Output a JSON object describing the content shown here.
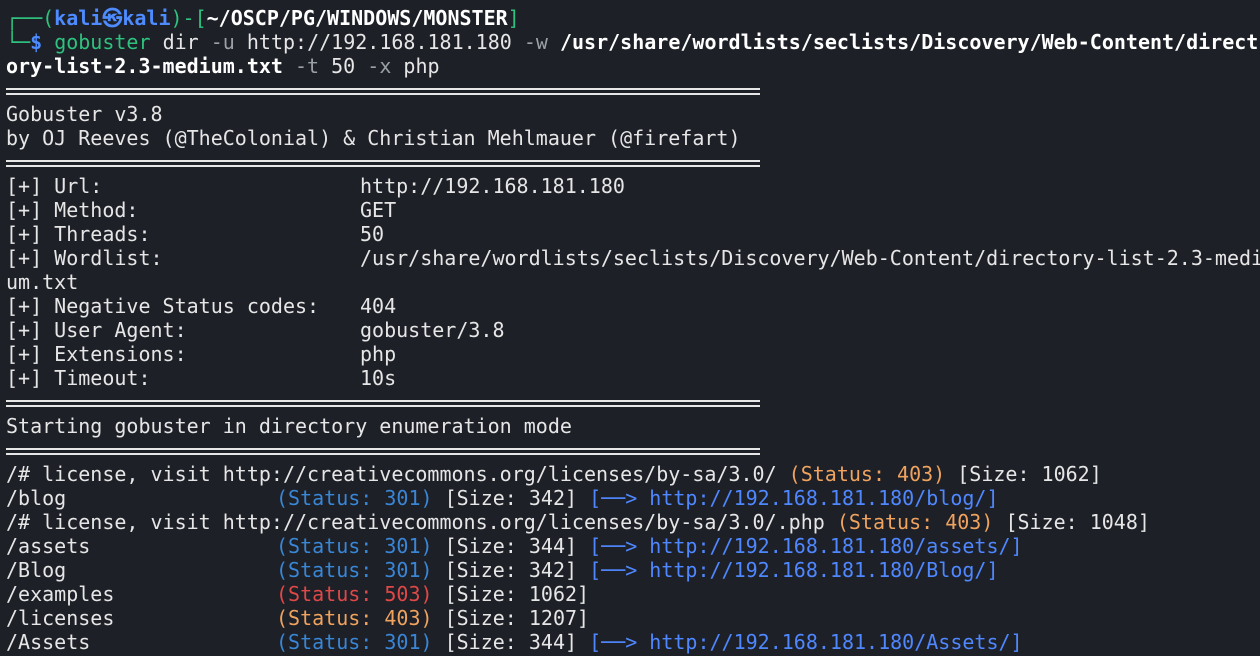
{
  "prompt": {
    "open": "┌──(",
    "user": "kali",
    "skull": "㉿",
    "host": "kali",
    "mid": ")-[",
    "path": "~/OSCP/PG/WINDOWS/MONSTER",
    "close": "]",
    "line2_prefix": "└─",
    "dollar": "$"
  },
  "command": {
    "cmd": "gobuster",
    "arg1": "dir",
    "flag_u": "-u",
    "url": "http://192.168.181.180",
    "flag_w": "-w",
    "wordlist_part1": "/usr/share/wordlists/seclists/Discovery/Web-Content/direct",
    "wordlist_part2": "ory-list-2.3-medium.txt",
    "flag_t": "-t",
    "threads": "50",
    "flag_x": "-x",
    "ext": "php"
  },
  "banner": {
    "version": "Gobuster v3.8",
    "authors": "by OJ Reeves (@TheColonial) & Christian Mehlmauer (@firefart)"
  },
  "config": {
    "url_label": "[+] Url:",
    "url_value": "http://192.168.181.180",
    "method_label": "[+] Method:",
    "method_value": "GET",
    "threads_label": "[+] Threads:",
    "threads_value": "50",
    "wordlist_label": "[+] Wordlist:",
    "wordlist_value": "/usr/share/wordlists/seclists/Discovery/Web-Content/directory-list-2.3-medi",
    "wordlist_wrap": "um.txt",
    "neg_label": "[+] Negative Status codes:",
    "neg_value": "404",
    "ua_label": "[+] User Agent:",
    "ua_value": "gobuster/3.8",
    "ext_label": "[+] Extensions:",
    "ext_value": "php",
    "timeout_label": "[+] Timeout:",
    "timeout_value": "10s"
  },
  "start_msg": "Starting gobuster in directory enumeration mode",
  "results": {
    "r1": {
      "path": "/# license, visit http://creativecommons.org/licenses/by-sa/3.0/",
      "status": "(Status: 403)",
      "size": "[Size: 1062]"
    },
    "r2": {
      "path": "/blog",
      "status": "(Status: 301)",
      "size": "[Size: 342]",
      "redirect": "[──> http://192.168.181.180/blog/]"
    },
    "r3": {
      "path": "/# license, visit http://creativecommons.org/licenses/by-sa/3.0/.php",
      "status": "(Status: 403)",
      "size": "[Size: 1048]"
    },
    "r4": {
      "path": "/assets",
      "status": "(Status: 301)",
      "size": "[Size: 344]",
      "redirect": "[──> http://192.168.181.180/assets/]"
    },
    "r5": {
      "path": "/Blog",
      "status": "(Status: 301)",
      "size": "[Size: 342]",
      "redirect": "[──> http://192.168.181.180/Blog/]"
    },
    "r6": {
      "path": "/examples",
      "status": "(Status: 503)",
      "size": "[Size: 1062]"
    },
    "r7": {
      "path": "/licenses",
      "status": "(Status: 403)",
      "size": "[Size: 1207]"
    },
    "r8": {
      "path": "/Assets",
      "status": "(Status: 301)",
      "size": "[Size: 344]",
      "redirect": "[──> http://192.168.181.180/Assets/]"
    }
  }
}
